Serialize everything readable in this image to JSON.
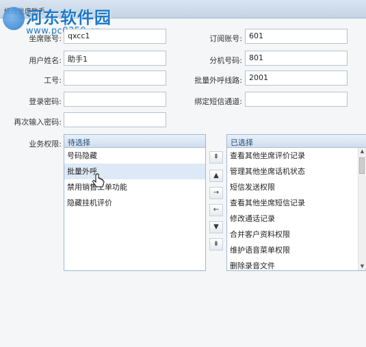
{
  "window": {
    "title": "修改坐席助手"
  },
  "watermark": {
    "site_name": "河东软件园",
    "url": "www.pc0359.cn"
  },
  "form": {
    "seat_account": {
      "label": "坐席账号:",
      "value": "qxcc1"
    },
    "subscribe_account": {
      "label": "订阅账号:",
      "value": "601"
    },
    "user_name": {
      "label": "用户姓名:",
      "value": "助手1"
    },
    "extension": {
      "label": "分机号码:",
      "value": "801"
    },
    "job_number": {
      "label": "工号:",
      "value": ""
    },
    "batch_outbound_line": {
      "label": "批量外呼线路:",
      "value": "2001"
    },
    "login_password": {
      "label": "登录密码:",
      "value": ""
    },
    "bind_sms_channel": {
      "label": "绑定短信通道:",
      "value": ""
    },
    "confirm_password": {
      "label": "再次输入密码:",
      "value": ""
    }
  },
  "permissions": {
    "label": "业务权限:",
    "available": {
      "header": "待选择",
      "items": [
        "号码隐藏",
        "批量外呼",
        "禁用销售工单功能",
        "隐藏挂机评价"
      ],
      "selected_item": "批量外呼"
    },
    "selected": {
      "header": "已选择",
      "items": [
        "查看其他坐席评价记录",
        "管理其他坐席话机状态",
        "短信发送权限",
        "查看其他坐席短信记录",
        "修改通话记录",
        "合并客户资料权限",
        "维护语音菜单权限",
        "删除录音文件"
      ]
    },
    "buttons": {
      "move_top": "⇞",
      "move_up": "▲",
      "add": "→",
      "remove": "←",
      "move_down": "▼",
      "move_bottom": "⇟"
    }
  },
  "colors": {
    "accent": "#1d79c9",
    "panel_header": "#cfdeee",
    "selection": "#dde9f6"
  }
}
